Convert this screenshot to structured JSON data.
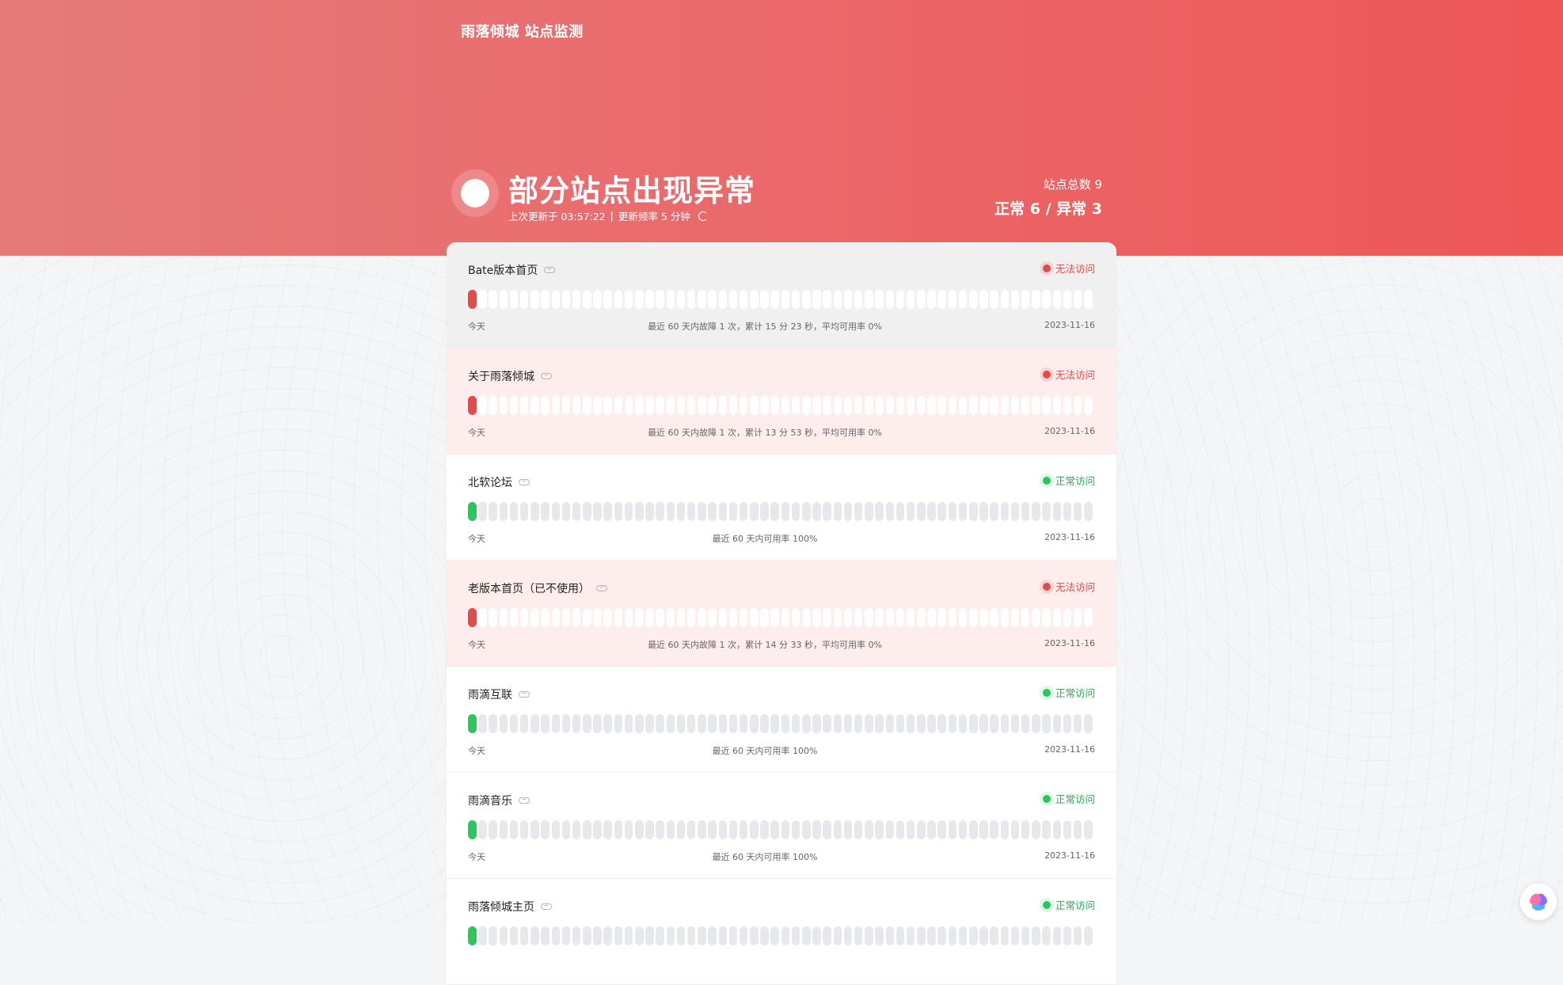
{
  "header": {
    "brand": "雨落倾城 站点监测",
    "title": "部分站点出现异常",
    "last_updated": "上次更新于 03:57:22",
    "separator": "|",
    "refresh_rate": "更新频率 5 分钟",
    "total_sites": "站点总数 9",
    "summary": "正常 6 / 异常 3",
    "hero_color": "#ef5656"
  },
  "colors": {
    "down": "#e24b4b",
    "up": "#2dc65e",
    "bar_idle": "#e6e8eb"
  },
  "sites": [
    {
      "name": "Bate版本首页",
      "status": "down",
      "status_label": "无法访问",
      "left": "今天",
      "stats": "最近 60 天内故障 1 次，累计 15 分 23 秒，平均可用率 0%",
      "date": "2023-11-16",
      "variant": "first"
    },
    {
      "name": "关于雨落倾城",
      "status": "down",
      "status_label": "无法访问",
      "left": "今天",
      "stats": "最近 60 天内故障 1 次，累计 13 分 53 秒，平均可用率 0%",
      "date": "2023-11-16",
      "variant": "down"
    },
    {
      "name": "北软论坛",
      "status": "up",
      "status_label": "正常访问",
      "left": "今天",
      "stats": "最近 60 天内可用率 100%",
      "date": "2023-11-16",
      "variant": "up"
    },
    {
      "name": "老版本首页（已不使用）",
      "status": "down",
      "status_label": "无法访问",
      "left": "今天",
      "stats": "最近 60 天内故障 1 次，累计 14 分 33 秒，平均可用率 0%",
      "date": "2023-11-16",
      "variant": "down"
    },
    {
      "name": "雨滴互联",
      "status": "up",
      "status_label": "正常访问",
      "left": "今天",
      "stats": "最近 60 天内可用率 100%",
      "date": "2023-11-16",
      "variant": "up"
    },
    {
      "name": "雨滴音乐",
      "status": "up",
      "status_label": "正常访问",
      "left": "今天",
      "stats": "最近 60 天内可用率 100%",
      "date": "2023-11-16",
      "variant": "up"
    },
    {
      "name": "雨落倾城主页",
      "status": "up",
      "status_label": "正常访问",
      "left": "",
      "stats": "",
      "date": "",
      "variant": "up"
    }
  ],
  "bar_count": 60,
  "ai_button_icon": "brain-icon"
}
